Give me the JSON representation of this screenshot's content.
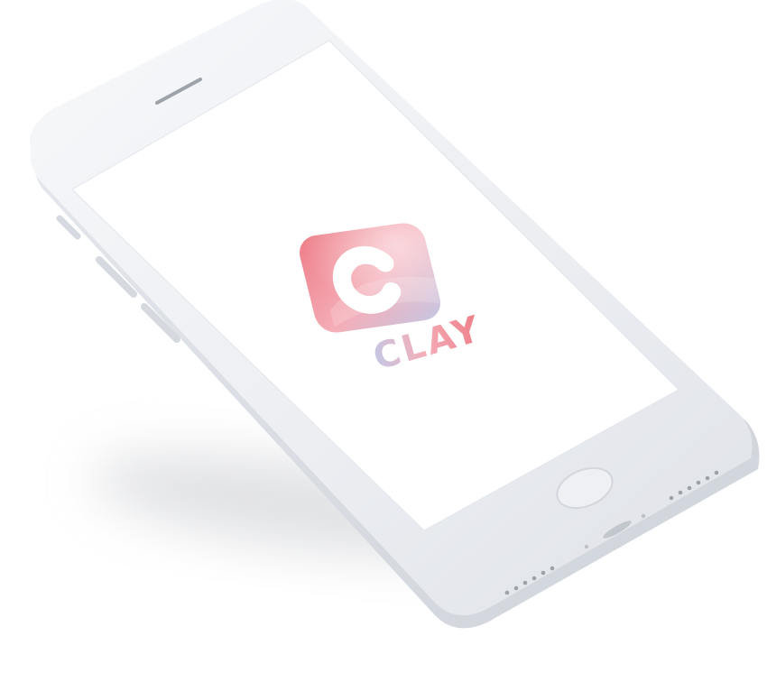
{
  "device": {
    "type": "smartphone-mockup",
    "finish_color": "#eef0f3",
    "screen_color": "#ffffff"
  },
  "app": {
    "logo_icon": "clay-logo-icon",
    "wordmark": "CLAY",
    "colors": {
      "brand_red": "#ee7d87",
      "brand_pink": "#f4aeb8",
      "brand_lavender": "#c5c7e4"
    }
  }
}
